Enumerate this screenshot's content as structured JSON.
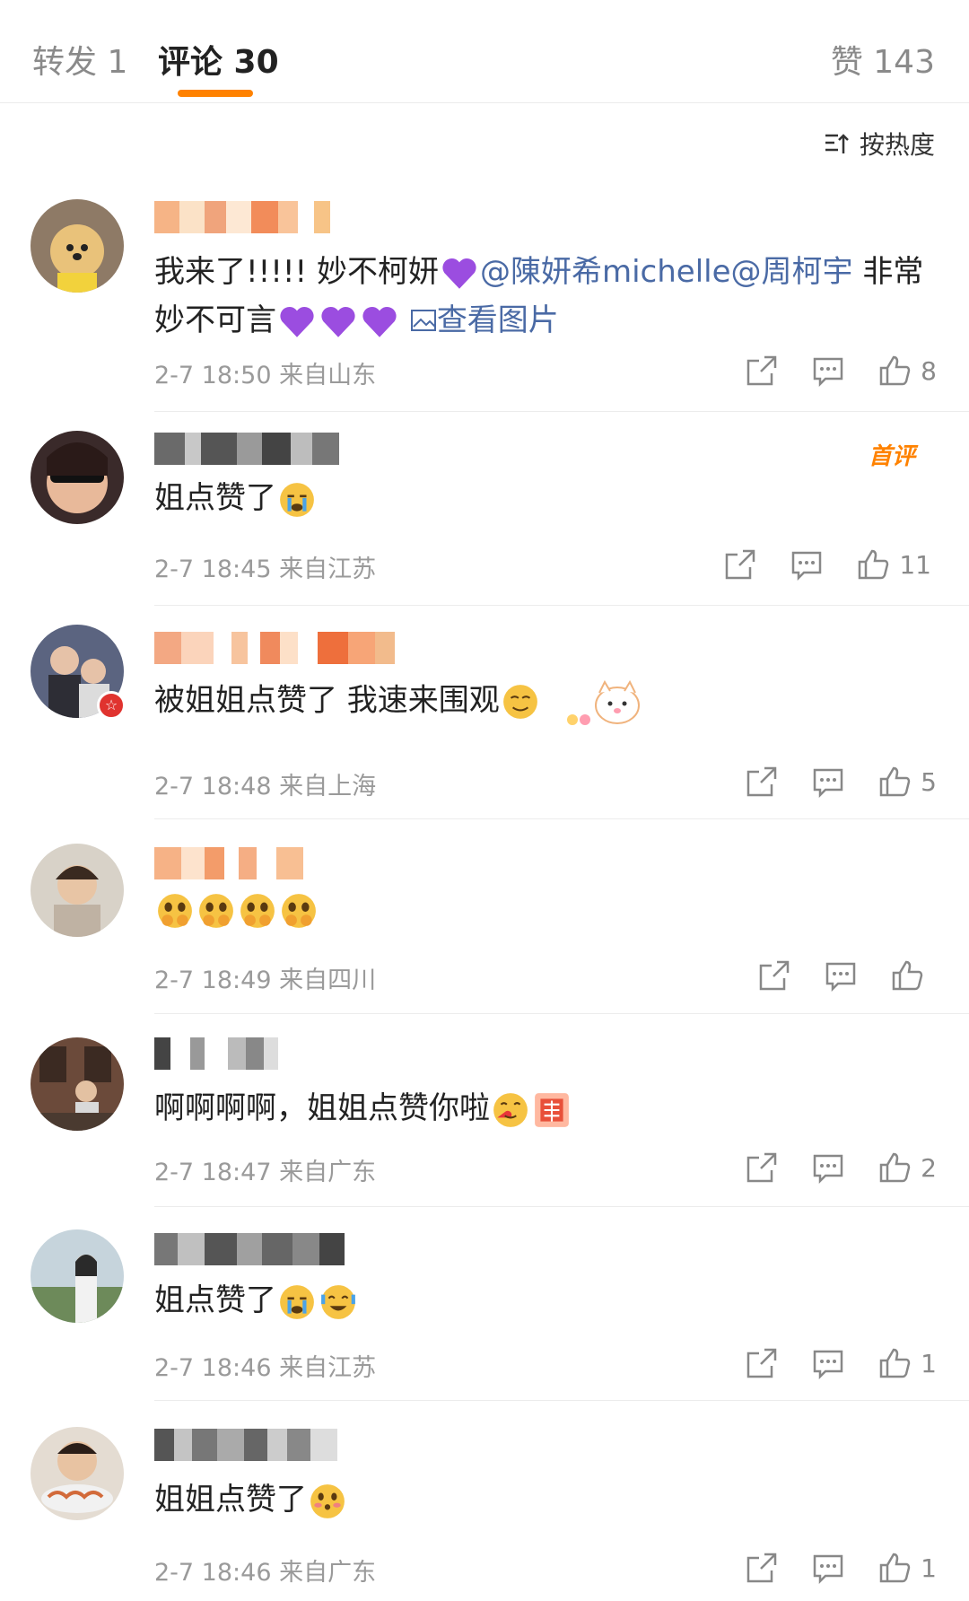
{
  "tabs": {
    "repost": "转发 1",
    "comments": "评论 30",
    "likes": "赞 143"
  },
  "sort_label": "按热度",
  "colors": {
    "accent": "#ff8200",
    "link": "#4a6aa5",
    "meta": "#9a9a9a"
  },
  "comments": [
    {
      "text_prefix": "我来了!!!!!   妙不柯妍",
      "mention1": "@陳妍希michelle",
      "mention2": "@周柯宇",
      "text_suffix": " 非常妙不可言",
      "link": "查看图片",
      "time": "2-7 18:50",
      "location": "来自山东",
      "likes": "8"
    },
    {
      "tag": "首评",
      "text": "姐点赞了",
      "time": "2-7 18:45",
      "location": "来自江苏",
      "likes": "11"
    },
    {
      "text": "被姐姐点赞了 我速来围观",
      "time": "2-7 18:48",
      "location": "来自上海",
      "likes": "5"
    },
    {
      "text": "",
      "time": "2-7 18:49",
      "location": "来自四川",
      "likes": ""
    },
    {
      "text": "啊啊啊啊，姐姐点赞你啦",
      "time": "2-7 18:47",
      "location": "来自广东",
      "likes": "2"
    },
    {
      "text": "姐点赞了",
      "time": "2-7 18:46",
      "location": "来自江苏",
      "likes": "1"
    },
    {
      "text": "姐姐点赞了",
      "time": "2-7 18:46",
      "location": "来自广东",
      "likes": "1"
    }
  ]
}
